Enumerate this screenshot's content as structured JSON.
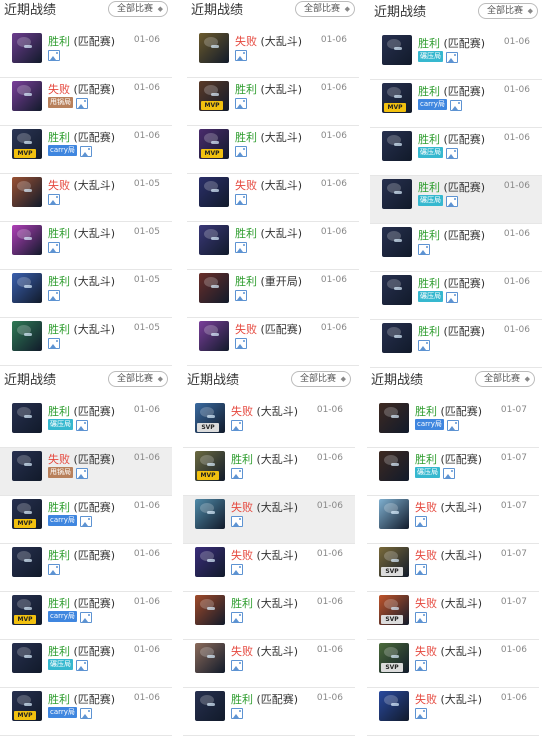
{
  "panels": [
    {
      "title": "近期战绩",
      "filter_label": "全部比赛",
      "rows": [
        {
          "result": "胜利",
          "mode": "(匹配赛)",
          "date": "01-06",
          "tags": [],
          "badge": "",
          "color": "#6d3d8f"
        },
        {
          "result": "失败",
          "mode": "(匹配赛)",
          "date": "01-06",
          "tags": [
            "甩锅局"
          ],
          "badge": "",
          "color": "#7b3f9b"
        },
        {
          "result": "胜利",
          "mode": "(匹配赛)",
          "date": "01-06",
          "tags": [
            "carry局"
          ],
          "badge": "MVP",
          "color": "#2c3656"
        },
        {
          "result": "失败",
          "mode": "(大乱斗)",
          "date": "01-05",
          "tags": [],
          "badge": "",
          "color": "#9a5133"
        },
        {
          "result": "胜利",
          "mode": "(大乱斗)",
          "date": "01-05",
          "tags": [],
          "badge": "",
          "color": "#b03fb8"
        },
        {
          "result": "胜利",
          "mode": "(大乱斗)",
          "date": "01-05",
          "tags": [],
          "badge": "",
          "color": "#3a5fae"
        },
        {
          "result": "胜利",
          "mode": "(大乱斗)",
          "date": "01-05",
          "tags": [],
          "badge": "",
          "color": "#2f7a55"
        }
      ]
    },
    {
      "title": "近期战绩",
      "filter_label": "全部比赛",
      "rows": [
        {
          "result": "失败",
          "mode": "(大乱斗)",
          "date": "01-06",
          "tags": [],
          "badge": "",
          "color": "#6b5a2c"
        },
        {
          "result": "胜利",
          "mode": "(大乱斗)",
          "date": "01-06",
          "tags": [],
          "badge": "MVP",
          "color": "#5a3a28"
        },
        {
          "result": "胜利",
          "mode": "(大乱斗)",
          "date": "01-06",
          "tags": [],
          "badge": "MVP",
          "color": "#4a2b6d"
        },
        {
          "result": "失败",
          "mode": "(大乱斗)",
          "date": "01-06",
          "tags": [],
          "badge": "",
          "color": "#2b2f6a"
        },
        {
          "result": "胜利",
          "mode": "(大乱斗)",
          "date": "01-06",
          "tags": [],
          "badge": "",
          "color": "#3a3878"
        },
        {
          "result": "胜利",
          "mode": "(重开局)",
          "date": "01-06",
          "tags": [],
          "badge": "",
          "color": "#6a2f2a"
        },
        {
          "result": "失败",
          "mode": "(匹配赛)",
          "date": "01-06",
          "tags": [],
          "badge": "",
          "color": "#7b3f9b"
        }
      ]
    },
    {
      "title": "近期战绩",
      "filter_label": "全部比赛",
      "rows": [
        {
          "result": "胜利",
          "mode": "(匹配赛)",
          "date": "01-06",
          "tags": [
            "碾压局"
          ],
          "badge": "",
          "color": "#27304f"
        },
        {
          "result": "胜利",
          "mode": "(匹配赛)",
          "date": "01-06",
          "tags": [
            "carry局"
          ],
          "badge": "MVP",
          "color": "#27304f"
        },
        {
          "result": "胜利",
          "mode": "(匹配赛)",
          "date": "01-06",
          "tags": [
            "碾压局"
          ],
          "badge": "",
          "color": "#27304f"
        },
        {
          "result": "胜利",
          "mode": "(匹配赛)",
          "date": "01-06",
          "tags": [
            "碾压局"
          ],
          "badge": "",
          "color": "#27304f",
          "highlight": true
        },
        {
          "result": "胜利",
          "mode": "(匹配赛)",
          "date": "01-06",
          "tags": [],
          "badge": "",
          "color": "#27304f"
        },
        {
          "result": "胜利",
          "mode": "(匹配赛)",
          "date": "01-06",
          "tags": [
            "碾压局"
          ],
          "badge": "",
          "color": "#27304f"
        },
        {
          "result": "胜利",
          "mode": "(匹配赛)",
          "date": "01-06",
          "tags": [],
          "badge": "",
          "color": "#27304f"
        }
      ]
    },
    {
      "title": "近期战绩",
      "filter_label": "全部比赛",
      "rows": [
        {
          "result": "胜利",
          "mode": "(匹配赛)",
          "date": "01-06",
          "tags": [
            "碾压局"
          ],
          "badge": "",
          "color": "#27304f"
        },
        {
          "result": "失败",
          "mode": "(匹配赛)",
          "date": "01-06",
          "tags": [
            "甩锅局"
          ],
          "badge": "",
          "color": "#27304f",
          "highlight": true
        },
        {
          "result": "胜利",
          "mode": "(匹配赛)",
          "date": "01-06",
          "tags": [
            "carry局"
          ],
          "badge": "MVP",
          "color": "#27304f"
        },
        {
          "result": "胜利",
          "mode": "(匹配赛)",
          "date": "01-06",
          "tags": [],
          "badge": "",
          "color": "#27304f"
        },
        {
          "result": "胜利",
          "mode": "(匹配赛)",
          "date": "01-06",
          "tags": [
            "carry局"
          ],
          "badge": "MVP",
          "color": "#27304f"
        },
        {
          "result": "胜利",
          "mode": "(匹配赛)",
          "date": "01-06",
          "tags": [
            "碾压局"
          ],
          "badge": "",
          "color": "#27304f"
        },
        {
          "result": "胜利",
          "mode": "(匹配赛)",
          "date": "01-06",
          "tags": [
            "carry局"
          ],
          "badge": "MVP",
          "color": "#27304f"
        }
      ]
    },
    {
      "title": "近期战绩",
      "filter_label": "全部比赛",
      "rows": [
        {
          "result": "失败",
          "mode": "(大乱斗)",
          "date": "01-06",
          "tags": [],
          "badge": "SVP",
          "color": "#3a6aa0"
        },
        {
          "result": "胜利",
          "mode": "(大乱斗)",
          "date": "01-06",
          "tags": [],
          "badge": "MVP",
          "color": "#6b6a40"
        },
        {
          "result": "失败",
          "mode": "(大乱斗)",
          "date": "01-06",
          "tags": [],
          "badge": "",
          "color": "#4f8aa8",
          "highlight": true
        },
        {
          "result": "失败",
          "mode": "(大乱斗)",
          "date": "01-06",
          "tags": [],
          "badge": "",
          "color": "#3a2d7a"
        },
        {
          "result": "胜利",
          "mode": "(大乱斗)",
          "date": "01-06",
          "tags": [],
          "badge": "",
          "color": "#a04a2a"
        },
        {
          "result": "失败",
          "mode": "(大乱斗)",
          "date": "01-06",
          "tags": [],
          "badge": "",
          "color": "#8a6a5a"
        },
        {
          "result": "胜利",
          "mode": "(匹配赛)",
          "date": "01-06",
          "tags": [],
          "badge": "",
          "color": "#27304f"
        }
      ]
    },
    {
      "title": "近期战绩",
      "filter_label": "全部比赛",
      "rows": [
        {
          "result": "胜利",
          "mode": "(匹配赛)",
          "date": "01-07",
          "tags": [
            "carry局"
          ],
          "badge": "",
          "color": "#3e2a22"
        },
        {
          "result": "胜利",
          "mode": "(匹配赛)",
          "date": "01-07",
          "tags": [
            "碾压局"
          ],
          "badge": "",
          "color": "#3e2a22"
        },
        {
          "result": "失败",
          "mode": "(大乱斗)",
          "date": "01-07",
          "tags": [],
          "badge": "",
          "color": "#7fb0d0"
        },
        {
          "result": "失败",
          "mode": "(大乱斗)",
          "date": "01-07",
          "tags": [],
          "badge": "SVP",
          "color": "#7a6a3a"
        },
        {
          "result": "失败",
          "mode": "(大乱斗)",
          "date": "01-07",
          "tags": [],
          "badge": "SVP",
          "color": "#c0542a"
        },
        {
          "result": "失败",
          "mode": "(大乱斗)",
          "date": "01-06",
          "tags": [],
          "badge": "SVP",
          "color": "#4a6a3a"
        },
        {
          "result": "失败",
          "mode": "(大乱斗)",
          "date": "01-06",
          "tags": [],
          "badge": "",
          "color": "#2a4aa0"
        }
      ]
    }
  ]
}
